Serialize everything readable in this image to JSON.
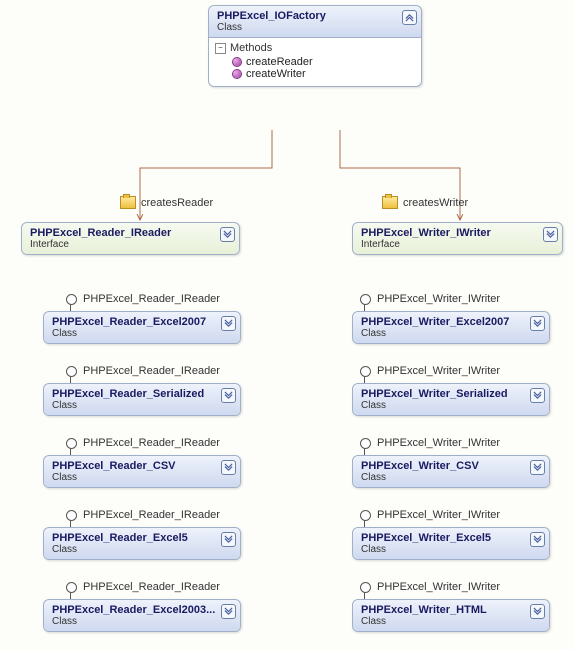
{
  "factory": {
    "title": "PHPExcel_IOFactory",
    "subtitle": "Class",
    "methods_section": "Methods",
    "methods": [
      "createReader",
      "createWriter"
    ]
  },
  "relations": {
    "createsReader": "createsReader",
    "createsWriter": "createsWriter"
  },
  "reader_interface": {
    "title": "PHPExcel_Reader_IReader",
    "subtitle": "Interface",
    "label": "PHPExcel_Reader_IReader"
  },
  "writer_interface": {
    "title": "PHPExcel_Writer_IWriter",
    "subtitle": "Interface",
    "label": "PHPExcel_Writer_IWriter"
  },
  "reader_classes": [
    {
      "title": "PHPExcel_Reader_Excel2007",
      "subtitle": "Class"
    },
    {
      "title": "PHPExcel_Reader_Serialized",
      "subtitle": "Class"
    },
    {
      "title": "PHPExcel_Reader_CSV",
      "subtitle": "Class"
    },
    {
      "title": "PHPExcel_Reader_Excel5",
      "subtitle": "Class"
    },
    {
      "title": "PHPExcel_Reader_Excel2003...",
      "subtitle": "Class"
    }
  ],
  "writer_classes": [
    {
      "title": "PHPExcel_Writer_Excel2007",
      "subtitle": "Class"
    },
    {
      "title": "PHPExcel_Writer_Serialized",
      "subtitle": "Class"
    },
    {
      "title": "PHPExcel_Writer_CSV",
      "subtitle": "Class"
    },
    {
      "title": "PHPExcel_Writer_Excel5",
      "subtitle": "Class"
    },
    {
      "title": "PHPExcel_Writer_HTML",
      "subtitle": "Class"
    }
  ]
}
